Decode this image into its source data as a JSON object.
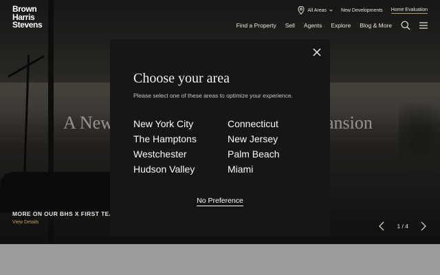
{
  "brand": {
    "logo_lines": [
      "Brown",
      "Harris",
      "Stevens"
    ]
  },
  "topbar": {
    "areas_label": "All Areas",
    "new_developments": "New Developments",
    "home_evaluation": "Home Evaluation"
  },
  "nav": {
    "items": [
      "Find a Property",
      "Sell",
      "Agents",
      "Explore",
      "Blog & More"
    ]
  },
  "hero": {
    "headline_left": "A New",
    "headline_right": "ansion"
  },
  "feature": {
    "title": "MORE ON OUR BHS X FIRST TEAM",
    "link": "View Details",
    "pager": "1 / 4"
  },
  "modal": {
    "title": "Choose your area",
    "subtitle": "Please select one of these areas to optimize your experience.",
    "areas_left": [
      "New York City",
      "The Hamptons",
      "Westchester",
      "Hudson Valley"
    ],
    "areas_right": [
      "Connecticut",
      "New Jersey",
      "Palm Beach",
      "Miami"
    ],
    "no_preference": "No Preference"
  },
  "colors": {
    "accent_gold": "#b8a06a",
    "modal_bg": "#161616"
  }
}
